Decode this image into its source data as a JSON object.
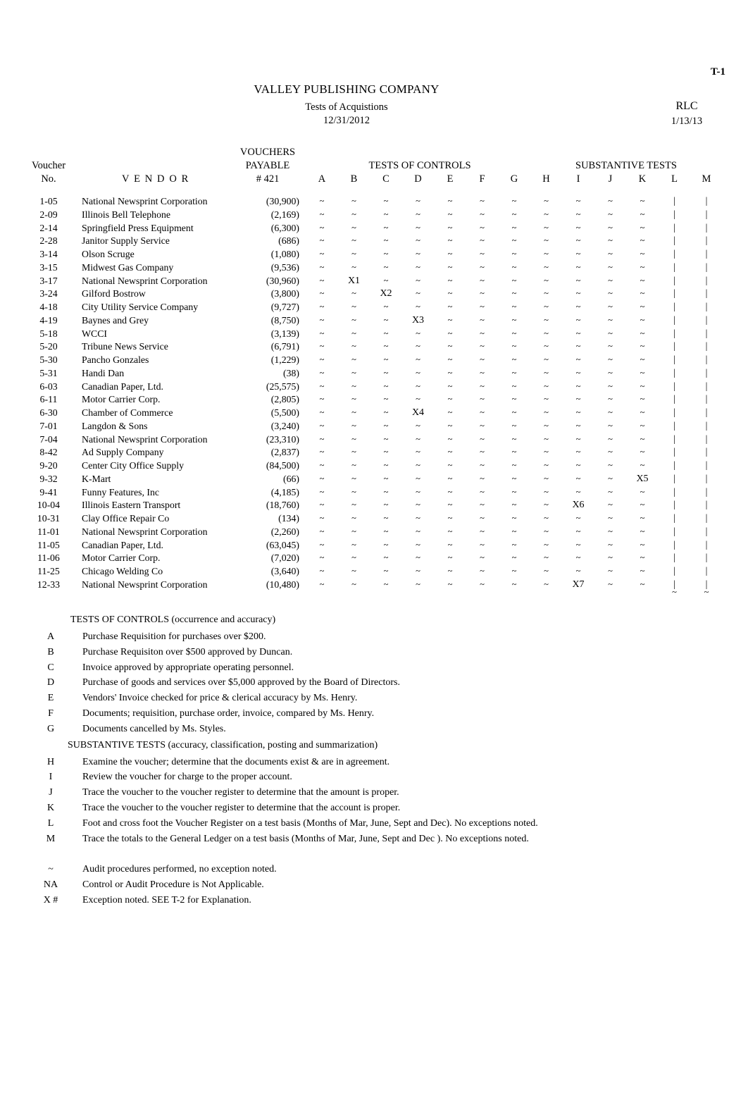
{
  "header": {
    "workpaper_ref": "T-1",
    "company": "VALLEY PUBLISHING COMPANY",
    "subtitle": "Tests of Acquistions",
    "period_date": "12/31/2012",
    "preparer_initials": "RLC",
    "prepared_date": "1/13/13"
  },
  "table": {
    "col_headers": {
      "voucher": "Voucher",
      "no": "No.",
      "vendor": "V E N D O R",
      "vouchers": "VOUCHERS",
      "payable": "PAYABLE",
      "account": "# 421",
      "tests_of_controls": "TESTS OF CONTROLS",
      "substantive_tests": "SUBSTANTIVE TESTS"
    },
    "letters": [
      "A",
      "B",
      "C",
      "D",
      "E",
      "F",
      "G",
      "H",
      "I",
      "J",
      "K",
      "L",
      "M"
    ],
    "tick_symbol": "~",
    "bar_symbol": "|",
    "foot_ticks": [
      "L",
      "M"
    ],
    "rows": [
      {
        "no": "1-05",
        "vendor": "National Newsprint Corporation",
        "amount": "(30,900)",
        "marks": [
          "~",
          "~",
          "~",
          "~",
          "~",
          "~",
          "~",
          "~",
          "~",
          "~",
          "~",
          "|",
          "|"
        ]
      },
      {
        "no": "2-09",
        "vendor": "Illinois Bell Telephone",
        "amount": "(2,169)",
        "marks": [
          "~",
          "~",
          "~",
          "~",
          "~",
          "~",
          "~",
          "~",
          "~",
          "~",
          "~",
          "|",
          "|"
        ]
      },
      {
        "no": "2-14",
        "vendor": "Springfield Press Equipment",
        "amount": "(6,300)",
        "marks": [
          "~",
          "~",
          "~",
          "~",
          "~",
          "~",
          "~",
          "~",
          "~",
          "~",
          "~",
          "|",
          "|"
        ]
      },
      {
        "no": "2-28",
        "vendor": "Janitor Supply Service",
        "amount": "(686)",
        "marks": [
          "~",
          "~",
          "~",
          "~",
          "~",
          "~",
          "~",
          "~",
          "~",
          "~",
          "~",
          "|",
          "|"
        ]
      },
      {
        "no": "3-14",
        "vendor": "Olson Scruge",
        "amount": "(1,080)",
        "marks": [
          "~",
          "~",
          "~",
          "~",
          "~",
          "~",
          "~",
          "~",
          "~",
          "~",
          "~",
          "|",
          "|"
        ]
      },
      {
        "no": "3-15",
        "vendor": "Midwest Gas Company",
        "amount": "(9,536)",
        "marks": [
          "~",
          "~",
          "~",
          "~",
          "~",
          "~",
          "~",
          "~",
          "~",
          "~",
          "~",
          "|",
          "|"
        ]
      },
      {
        "no": "3-17",
        "vendor": "National Newsprint Corporation",
        "amount": "(30,960)",
        "marks": [
          "~",
          "X1",
          "~",
          "~",
          "~",
          "~",
          "~",
          "~",
          "~",
          "~",
          "~",
          "|",
          "|"
        ]
      },
      {
        "no": "3-24",
        "vendor": "Gilford Bostrow",
        "amount": "(3,800)",
        "marks": [
          "~",
          "~",
          "X2",
          "~",
          "~",
          "~",
          "~",
          "~",
          "~",
          "~",
          "~",
          "|",
          "|"
        ]
      },
      {
        "no": "4-18",
        "vendor": "City Utility Service Company",
        "amount": "(9,727)",
        "marks": [
          "~",
          "~",
          "~",
          "~",
          "~",
          "~",
          "~",
          "~",
          "~",
          "~",
          "~",
          "|",
          "|"
        ]
      },
      {
        "no": "4-19",
        "vendor": "Baynes and Grey",
        "amount": "(8,750)",
        "marks": [
          "~",
          "~",
          "~",
          "X3",
          "~",
          "~",
          "~",
          "~",
          "~",
          "~",
          "~",
          "|",
          "|"
        ]
      },
      {
        "no": "5-18",
        "vendor": "WCCI",
        "amount": "(3,139)",
        "marks": [
          "~",
          "~",
          "~",
          "~",
          "~",
          "~",
          "~",
          "~",
          "~",
          "~",
          "~",
          "|",
          "|"
        ]
      },
      {
        "no": "5-20",
        "vendor": "Tribune News Service",
        "amount": "(6,791)",
        "marks": [
          "~",
          "~",
          "~",
          "~",
          "~",
          "~",
          "~",
          "~",
          "~",
          "~",
          "~",
          "|",
          "|"
        ]
      },
      {
        "no": "5-30",
        "vendor": "Pancho Gonzales",
        "amount": "(1,229)",
        "marks": [
          "~",
          "~",
          "~",
          "~",
          "~",
          "~",
          "~",
          "~",
          "~",
          "~",
          "~",
          "|",
          "|"
        ]
      },
      {
        "no": "5-31",
        "vendor": "Handi Dan",
        "amount": "(38)",
        "marks": [
          "~",
          "~",
          "~",
          "~",
          "~",
          "~",
          "~",
          "~",
          "~",
          "~",
          "~",
          "|",
          "|"
        ]
      },
      {
        "no": "6-03",
        "vendor": "Canadian Paper, Ltd.",
        "amount": "(25,575)",
        "marks": [
          "~",
          "~",
          "~",
          "~",
          "~",
          "~",
          "~",
          "~",
          "~",
          "~",
          "~",
          "|",
          "|"
        ]
      },
      {
        "no": "6-11",
        "vendor": "Motor Carrier Corp.",
        "amount": "(2,805)",
        "marks": [
          "~",
          "~",
          "~",
          "~",
          "~",
          "~",
          "~",
          "~",
          "~",
          "~",
          "~",
          "|",
          "|"
        ]
      },
      {
        "no": "6-30",
        "vendor": "Chamber of Commerce",
        "amount": "(5,500)",
        "marks": [
          "~",
          "~",
          "~",
          "X4",
          "~",
          "~",
          "~",
          "~",
          "~",
          "~",
          "~",
          "|",
          "|"
        ]
      },
      {
        "no": "7-01",
        "vendor": "Langdon & Sons",
        "amount": "(3,240)",
        "marks": [
          "~",
          "~",
          "~",
          "~",
          "~",
          "~",
          "~",
          "~",
          "~",
          "~",
          "~",
          "|",
          "|"
        ]
      },
      {
        "no": "7-04",
        "vendor": "National Newsprint Corporation",
        "amount": "(23,310)",
        "marks": [
          "~",
          "~",
          "~",
          "~",
          "~",
          "~",
          "~",
          "~",
          "~",
          "~",
          "~",
          "|",
          "|"
        ]
      },
      {
        "no": "8-42",
        "vendor": "Ad Supply Company",
        "amount": "(2,837)",
        "marks": [
          "~",
          "~",
          "~",
          "~",
          "~",
          "~",
          "~",
          "~",
          "~",
          "~",
          "~",
          "|",
          "|"
        ]
      },
      {
        "no": "9-20",
        "vendor": "Center City Office Supply",
        "amount": "(84,500)",
        "marks": [
          "~",
          "~",
          "~",
          "~",
          "~",
          "~",
          "~",
          "~",
          "~",
          "~",
          "~",
          "|",
          "|"
        ]
      },
      {
        "no": "9-32",
        "vendor": "K-Mart",
        "amount": "(66)",
        "marks": [
          "~",
          "~",
          "~",
          "~",
          "~",
          "~",
          "~",
          "~",
          "~",
          "~",
          "X5",
          "|",
          "|"
        ]
      },
      {
        "no": "9-41",
        "vendor": "Funny Features, Inc",
        "amount": "(4,185)",
        "marks": [
          "~",
          "~",
          "~",
          "~",
          "~",
          "~",
          "~",
          "~",
          "~",
          "~",
          "~",
          "|",
          "|"
        ]
      },
      {
        "no": "10-04",
        "vendor": "Illinois Eastern Transport",
        "amount": "(18,760)",
        "marks": [
          "~",
          "~",
          "~",
          "~",
          "~",
          "~",
          "~",
          "~",
          "X6",
          "~",
          "~",
          "|",
          "|"
        ]
      },
      {
        "no": "10-31",
        "vendor": "Clay Office Repair Co",
        "amount": "(134)",
        "marks": [
          "~",
          "~",
          "~",
          "~",
          "~",
          "~",
          "~",
          "~",
          "~",
          "~",
          "~",
          "|",
          "|"
        ]
      },
      {
        "no": "11-01",
        "vendor": "National Newsprint Corporation",
        "amount": "(2,260)",
        "marks": [
          "~",
          "~",
          "~",
          "~",
          "~",
          "~",
          "~",
          "~",
          "~",
          "~",
          "~",
          "|",
          "|"
        ]
      },
      {
        "no": "11-05",
        "vendor": "Canadian Paper, Ltd.",
        "amount": "(63,045)",
        "marks": [
          "~",
          "~",
          "~",
          "~",
          "~",
          "~",
          "~",
          "~",
          "~",
          "~",
          "~",
          "|",
          "|"
        ]
      },
      {
        "no": "11-06",
        "vendor": "Motor Carrier Corp.",
        "amount": "(7,020)",
        "marks": [
          "~",
          "~",
          "~",
          "~",
          "~",
          "~",
          "~",
          "~",
          "~",
          "~",
          "~",
          "|",
          "|"
        ]
      },
      {
        "no": "11-25",
        "vendor": "Chicago Welding Co",
        "amount": "(3,640)",
        "marks": [
          "~",
          "~",
          "~",
          "~",
          "~",
          "~",
          "~",
          "~",
          "~",
          "~",
          "~",
          "|",
          "|"
        ]
      },
      {
        "no": "12-33",
        "vendor": "National Newsprint Corporation",
        "amount": "(10,480)",
        "marks": [
          "~",
          "~",
          "~",
          "~",
          "~",
          "~",
          "~",
          "~",
          "X7",
          "~",
          "~",
          "|",
          "|"
        ]
      }
    ]
  },
  "legend": {
    "controls_heading": "TESTS OF CONTROLS (occurrence and accuracy)",
    "controls": [
      {
        "key": "A",
        "text": "Purchase Requisition for purchases over $200."
      },
      {
        "key": "B",
        "text": "Purchase Requisiton over $500 approved by Duncan."
      },
      {
        "key": "C",
        "text": "Invoice approved by appropriate operating personnel."
      },
      {
        "key": "D",
        "text": "Purchase of goods and services over $5,000 approved by the Board of Directors."
      },
      {
        "key": "E",
        "text": "Vendors' Invoice checked for price & clerical accuracy by Ms. Henry."
      },
      {
        "key": "F",
        "text": "Documents; requisition, purchase order, invoice, compared by Ms. Henry."
      },
      {
        "key": "G",
        "text": "Documents cancelled by Ms. Styles."
      }
    ],
    "substantive_heading": "SUBSTANTIVE TESTS (accuracy, classification, posting and summarization)",
    "substantive": [
      {
        "key": "H",
        "text": "Examine the voucher; determine that the documents exist & are in agreement."
      },
      {
        "key": "I",
        "text": "Review the voucher for charge to the proper account."
      },
      {
        "key": "J",
        "text": "Trace the voucher to the voucher register to determine that the amount is proper."
      },
      {
        "key": "K",
        "text": "Trace the voucher to the voucher register to determine that the account is proper."
      },
      {
        "key": "L",
        "text": "Foot and cross foot the Voucher Register on a test basis (Months of Mar, June, Sept and Dec). No exceptions noted."
      },
      {
        "key": "M",
        "text": "Trace the totals to the General Ledger on a test basis (Months of Mar, June, Sept and Dec ). No exceptions noted."
      }
    ],
    "symbols": [
      {
        "key": "~",
        "text": "Audit procedures performed, no exception noted."
      },
      {
        "key": "NA",
        "text": "Control or Audit Procedure is Not Applicable."
      },
      {
        "key": "X #",
        "text": "Exception noted.     SEE T-2 for Explanation."
      }
    ]
  }
}
